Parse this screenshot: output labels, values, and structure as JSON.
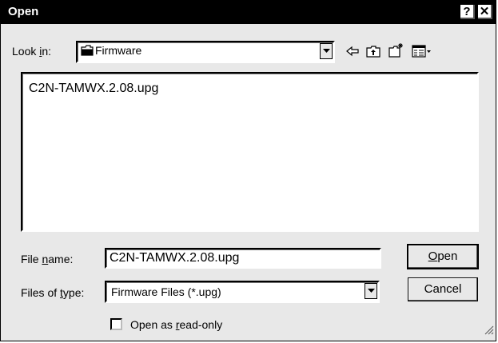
{
  "dialog": {
    "title": "Open",
    "help_glyph": "?",
    "close_glyph": "✕"
  },
  "look_in": {
    "label": "Look in:",
    "value": "Firmware",
    "folder_icon": "folder-icon"
  },
  "toolbar": {
    "icons": [
      "back-arrow-icon",
      "up-one-level-icon",
      "new-folder-icon",
      "view-menu-icon"
    ]
  },
  "files": [
    {
      "name": "C2N-TAMWX.2.08.upg"
    }
  ],
  "file_name": {
    "label": "File name:",
    "value": "C2N-TAMWX.2.08.upg"
  },
  "files_of_type": {
    "label": "Files of type:",
    "value": "Firmware Files (*.upg)"
  },
  "buttons": {
    "open": "Open",
    "cancel": "Cancel"
  },
  "read_only": {
    "label": "Open as read-only",
    "checked": false
  }
}
